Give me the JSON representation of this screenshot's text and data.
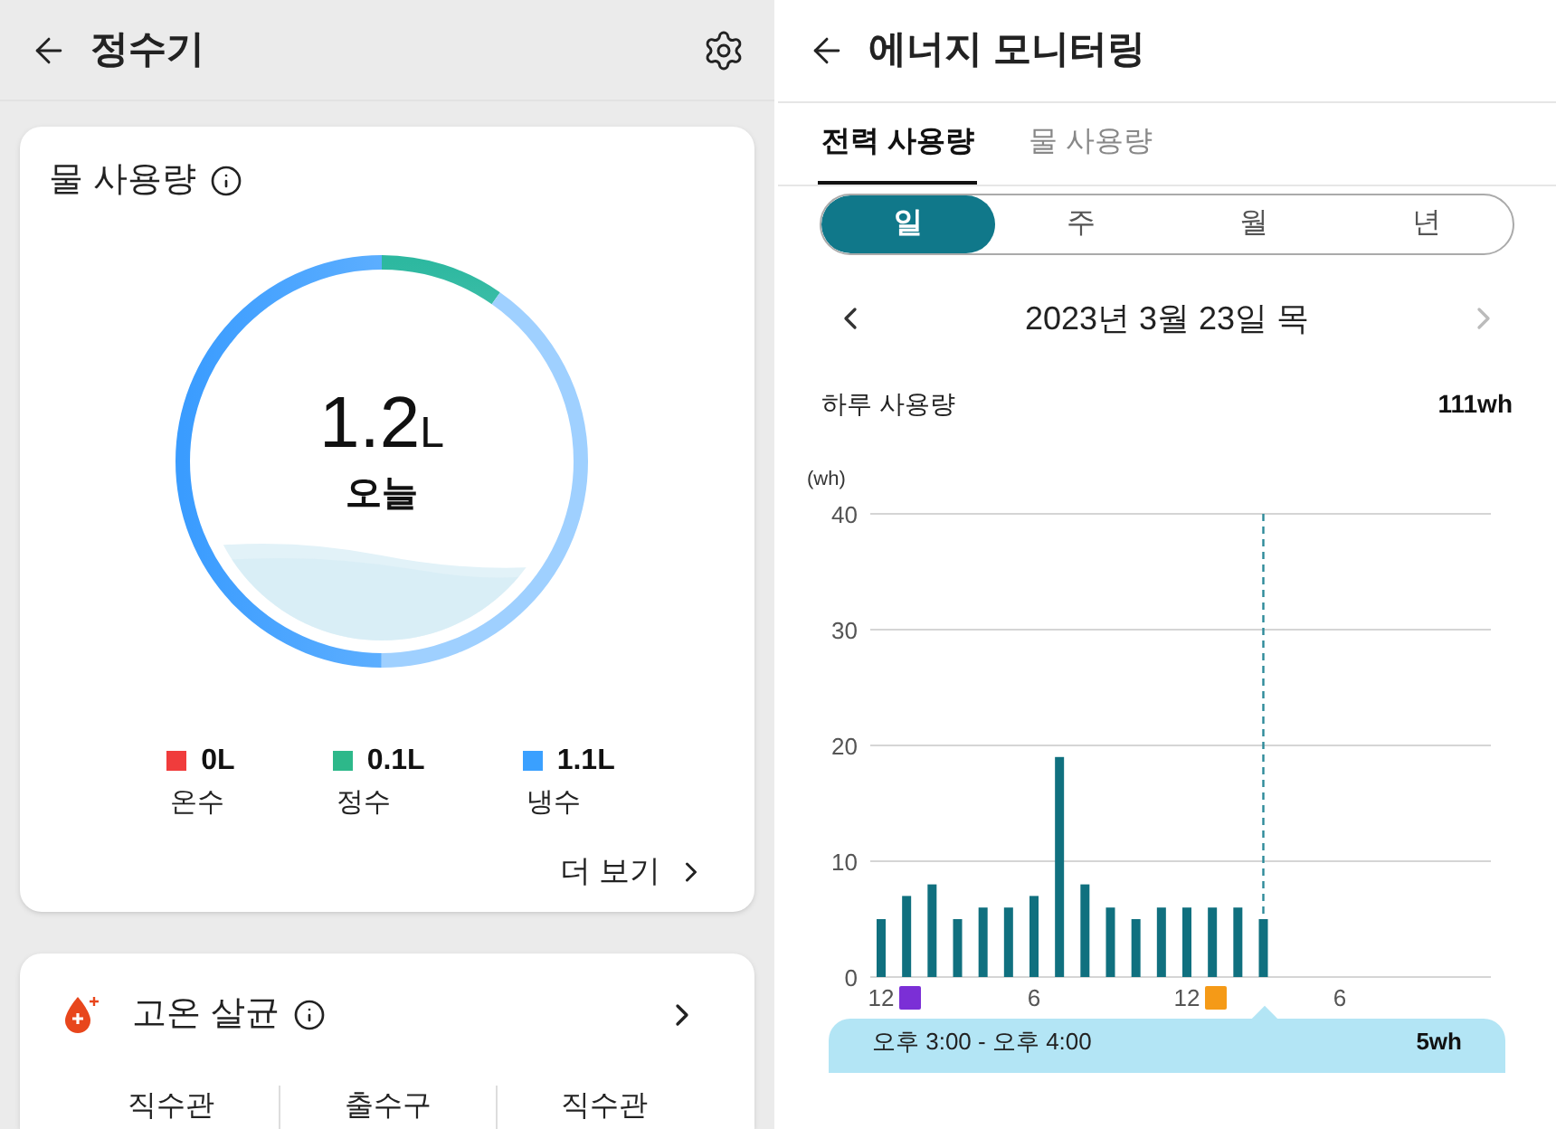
{
  "left": {
    "title": "정수기",
    "usage_card": {
      "title": "물 사용량",
      "total": "1.2",
      "unit": "L",
      "period": "오늘",
      "legend": [
        {
          "value": "0L",
          "label": "온수",
          "color": "#f03c3c"
        },
        {
          "value": "0.1L",
          "label": "정수",
          "color": "#2db88a"
        },
        {
          "value": "1.1L",
          "label": "냉수",
          "color": "#3aa0ff"
        }
      ],
      "more": "더 보기"
    },
    "sterilize_card": {
      "title": "고온 살균",
      "columns": [
        "직수관",
        "출수구",
        "직수관"
      ]
    }
  },
  "right": {
    "title": "에너지 모니터링",
    "tabs": [
      {
        "label": "전력 사용량",
        "selected": true
      },
      {
        "label": "물 사용량",
        "selected": false
      }
    ],
    "periods": [
      {
        "label": "일",
        "selected": true
      },
      {
        "label": "주",
        "selected": false
      },
      {
        "label": "월",
        "selected": false
      },
      {
        "label": "년",
        "selected": false
      }
    ],
    "date": "2023년 3월 23일 목",
    "prev_disabled": false,
    "next_disabled": true,
    "daily_label": "하루 사용량",
    "daily_value": "111wh",
    "chart_data": {
      "type": "bar",
      "ylabel": "(wh)",
      "categories": [
        "12",
        null,
        null,
        null,
        null,
        null,
        "6",
        null,
        null,
        null,
        null,
        null,
        "12",
        null,
        null,
        null,
        null,
        null,
        "6",
        null,
        null,
        null,
        null,
        null
      ],
      "values": [
        5,
        7,
        8,
        5,
        6,
        6,
        7,
        19,
        8,
        6,
        5,
        6,
        6,
        6,
        6,
        5,
        null,
        null,
        null,
        null,
        null,
        null,
        null,
        null
      ],
      "ylim": [
        0,
        40
      ],
      "yticks": [
        0,
        10,
        20,
        30,
        40
      ],
      "grid": true
    },
    "tooltip": {
      "range": "오후 3:00 - 오후 4:00",
      "value": "5wh"
    }
  }
}
